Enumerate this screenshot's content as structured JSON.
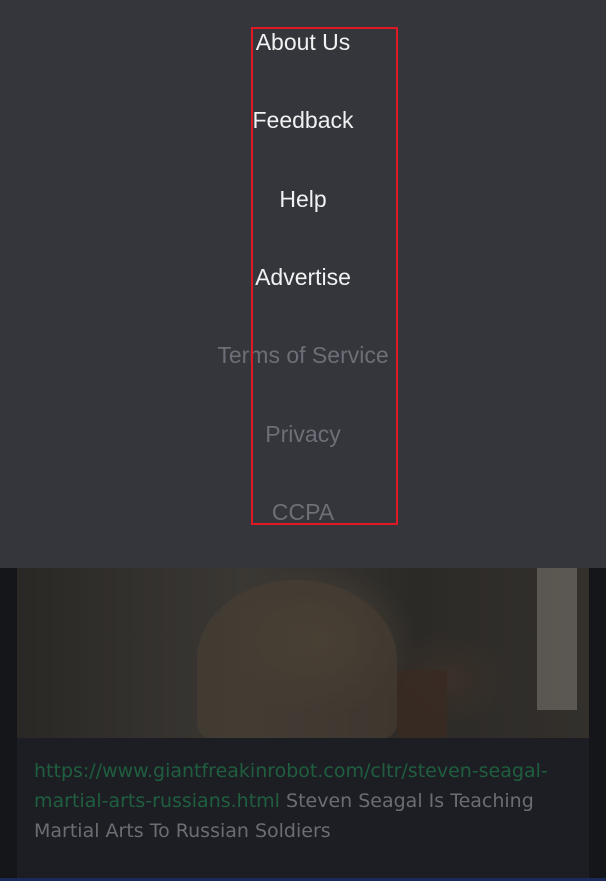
{
  "menu": {
    "items": [
      {
        "label": "About Us",
        "style": "primary"
      },
      {
        "label": "Feedback",
        "style": "primary"
      },
      {
        "label": "Help",
        "style": "primary"
      },
      {
        "label": "Advertise",
        "style": "primary"
      },
      {
        "label": "Terms of Service",
        "style": "secondary"
      },
      {
        "label": "Privacy",
        "style": "secondary"
      },
      {
        "label": "CCPA",
        "style": "secondary"
      }
    ]
  },
  "post": {
    "link_text": "https://www.giantfreakinrobot.com/cltr/steven-seagal-martial-arts-russians.html",
    "title": "Steven Seagal Is Teaching Martial Arts To Russian Soldiers"
  },
  "colors": {
    "menu_background": "#34363c",
    "primary_text": "#f1f1f2",
    "secondary_text": "#6c6f77",
    "highlight": "#e01a22",
    "link": "#1f5f3f"
  }
}
